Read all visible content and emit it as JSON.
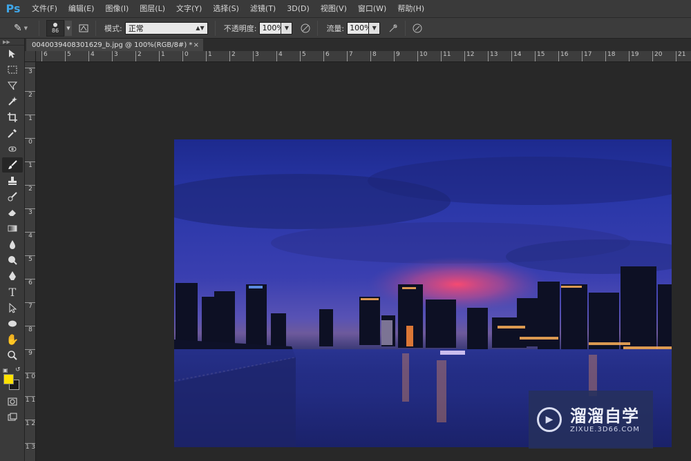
{
  "app": {
    "logo": "Ps"
  },
  "menu": [
    "文件(F)",
    "编辑(E)",
    "图像(I)",
    "图层(L)",
    "文字(Y)",
    "选择(S)",
    "滤镜(T)",
    "3D(D)",
    "视图(V)",
    "窗口(W)",
    "帮助(H)"
  ],
  "options": {
    "brush_size": "86",
    "mode_label": "模式:",
    "mode_value": "正常",
    "opacity_label": "不透明度:",
    "opacity_value": "100%",
    "flow_label": "流量:",
    "flow_value": "100%"
  },
  "document": {
    "tab_title": "0040039408301629_b.jpg @ 100%(RGB/8#) *",
    "close": "×"
  },
  "ruler_top": [
    "6",
    "5",
    "4",
    "3",
    "2",
    "1",
    "0",
    "1",
    "2",
    "3",
    "4",
    "5",
    "6",
    "7",
    "8",
    "9",
    "10",
    "11",
    "12",
    "13",
    "14",
    "15",
    "16",
    "17",
    "18",
    "19",
    "20",
    "21"
  ],
  "ruler_left": [
    "3",
    "2",
    "1",
    "0",
    "1",
    "2",
    "3",
    "4",
    "5",
    "6",
    "7",
    "8",
    "9",
    "1 0",
    "1 1",
    "1 2",
    "1 3"
  ],
  "colors": {
    "foreground": "#ffe200",
    "background": "#1a1a1a",
    "ps_blue": "#3fa6e8"
  },
  "watermark": {
    "title": "溜溜自学",
    "subtitle": "ZIXUE.3D66.COM"
  }
}
